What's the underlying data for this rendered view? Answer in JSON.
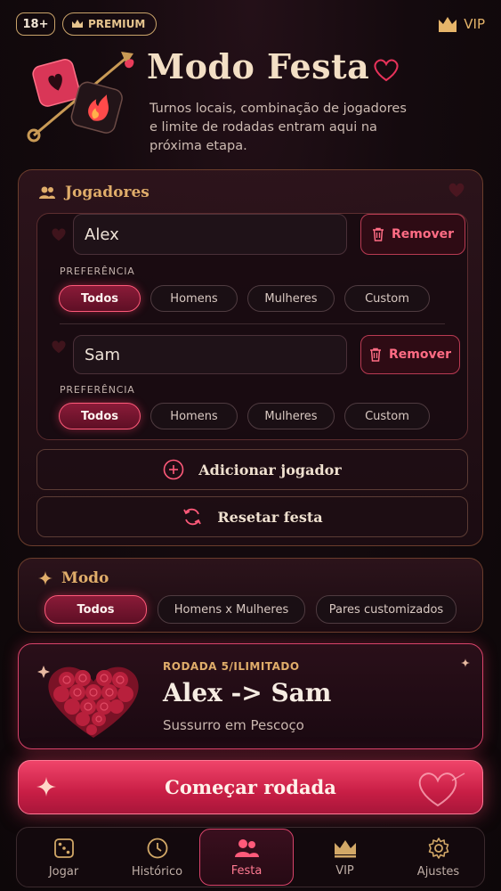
{
  "topbar": {
    "age_badge": "18+",
    "premium_label": "PREMIUM",
    "vip_label": "VIP"
  },
  "hero": {
    "title": "Modo Festa",
    "subtitle": "Turnos locais, combinação de jogadores e limite de rodadas entram aqui na próxima etapa."
  },
  "players_section": {
    "title": "Jogadores",
    "pref_label": "PREFERÊNCIA",
    "remove_label": "Remover",
    "preference_options": [
      "Todos",
      "Homens",
      "Mulheres",
      "Custom"
    ],
    "players": [
      {
        "name": "Alex",
        "selected_preference": "Todos"
      },
      {
        "name": "Sam",
        "selected_preference": "Todos"
      }
    ],
    "add_player_label": "Adicionar jogador",
    "reset_label": "Resetar festa"
  },
  "mode_section": {
    "title": "Modo",
    "options": [
      "Todos",
      "Homens x Mulheres",
      "Pares customizados"
    ],
    "selected": "Todos"
  },
  "round": {
    "label": "RODADA 5/ILIMITADO",
    "players": "Alex -> Sam",
    "action": "Sussurro em Pescoço"
  },
  "start_button": "Começar rodada",
  "nav": {
    "items": [
      {
        "label": "Jogar",
        "icon": "dice-icon"
      },
      {
        "label": "Histórico",
        "icon": "clock-icon"
      },
      {
        "label": "Festa",
        "icon": "people-icon"
      },
      {
        "label": "VIP",
        "icon": "crown-icon"
      },
      {
        "label": "Ajustes",
        "icon": "gear-icon"
      }
    ],
    "active": "Festa"
  },
  "colors": {
    "accent": "#e0ad6a",
    "primary": "#e8325a",
    "background": "#140a0e"
  }
}
